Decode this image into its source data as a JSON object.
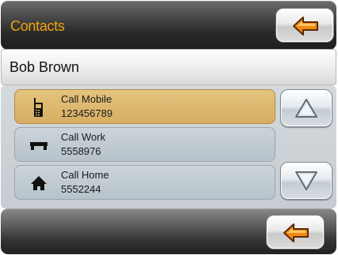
{
  "header": {
    "title": "Contacts",
    "back_icon": "arrow-left-icon",
    "accent_color": "#f0a30a"
  },
  "contact": {
    "name": "Bob Brown"
  },
  "list": {
    "items": [
      {
        "label": "Call Mobile",
        "number": "123456789",
        "icon": "mobile-phone-icon",
        "selected": true
      },
      {
        "label": "Call Work",
        "number": "5558976",
        "icon": "work-icon",
        "selected": false
      },
      {
        "label": "Call Home",
        "number": "5552244",
        "icon": "home-icon",
        "selected": false
      }
    ],
    "selected_color": "#d9b46a",
    "item_color": "#bfc9d0"
  },
  "scroll": {
    "up_icon": "arrow-up-icon",
    "down_icon": "arrow-down-icon"
  },
  "footer": {
    "back_icon": "arrow-left-icon"
  }
}
